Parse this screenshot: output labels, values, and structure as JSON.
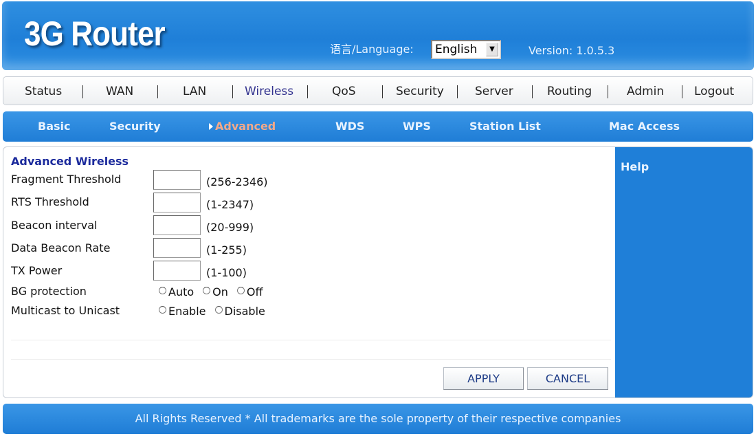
{
  "header": {
    "logo": "3G Router",
    "language_label": "语言/Language:",
    "language_selected": "English",
    "version": "Version: 1.0.5.3"
  },
  "main_nav": [
    {
      "label": "Status"
    },
    {
      "label": "WAN"
    },
    {
      "label": "LAN"
    },
    {
      "label": "Wireless",
      "active": true
    },
    {
      "label": "QoS"
    },
    {
      "label": "Security"
    },
    {
      "label": "Server"
    },
    {
      "label": "Routing"
    },
    {
      "label": "Admin"
    },
    {
      "label": "Logout"
    }
  ],
  "sub_nav": [
    {
      "label": "Basic"
    },
    {
      "label": "Security"
    },
    {
      "label": "Advanced",
      "active": true
    },
    {
      "label": "WDS"
    },
    {
      "label": "WPS"
    },
    {
      "label": "Station List"
    },
    {
      "label": "Mac Access"
    }
  ],
  "form": {
    "title": "Advanced Wireless",
    "fields": [
      {
        "label": "Fragment Threshold",
        "value": "",
        "range": "(256-2346)"
      },
      {
        "label": "RTS Threshold",
        "value": "",
        "range": "(1-2347)"
      },
      {
        "label": "Beacon interval",
        "value": "",
        "range": "(20-999)"
      },
      {
        "label": "Data Beacon Rate",
        "value": "",
        "range": "(1-255)"
      },
      {
        "label": "TX Power",
        "value": "",
        "range": "(1-100)"
      }
    ],
    "bg_protection": {
      "label": "BG protection",
      "options": [
        "Auto",
        "On",
        "Off"
      ]
    },
    "multicast": {
      "label": "Multicast to Unicast",
      "options": [
        "Enable",
        "Disable"
      ]
    },
    "apply_label": "APPLY",
    "cancel_label": "CANCEL"
  },
  "help": {
    "title": "Help"
  },
  "footer": {
    "text": "All Rights Reserved * All trademarks are the sole property of their respective companies"
  },
  "colors": {
    "header_blue": "#1f7fd8",
    "active_sub_tab": "#f2a98a",
    "section_title": "#1b2a9c"
  }
}
